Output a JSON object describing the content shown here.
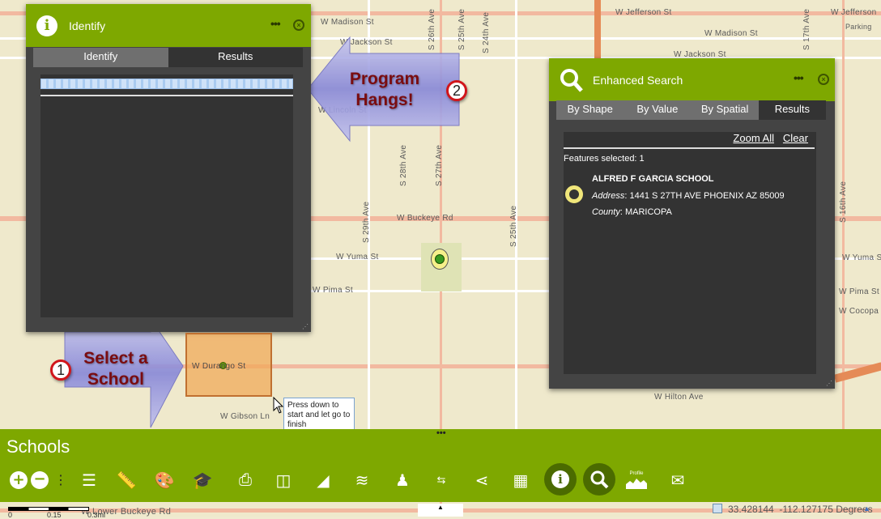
{
  "map": {
    "street_labels": [
      "W Madison St",
      "W Jackson St",
      "W Jefferson St",
      "W Madison St",
      "W Jackson St",
      "W Jefferson",
      "Parking",
      "W Lincoln St",
      "W Buckeye Rd",
      "W Yuma St",
      "W Pima St",
      "W Durango St",
      "W Gibson Ln",
      "W Hilton Ave",
      "W Lower Buckeye Rd",
      "S 26th Ave",
      "S 25th Ave",
      "S 24th Ave",
      "S 17th Ave",
      "S 28th Ave",
      "S 27th Ave",
      "S 29th Ave",
      "S 25th Ave",
      "S 16th Ave",
      "W Yuma St",
      "W Pima St",
      "W Cocopa St"
    ],
    "tooltip": "Press down to start and let go to finish",
    "scale_labels": [
      "0",
      "0.15",
      "0.3mi"
    ],
    "coordinates": "33.428144  -112.127175 Degrees"
  },
  "identify": {
    "title": "Identify",
    "menu": "•••",
    "close": "×",
    "tabs": [
      "Identify",
      "Results"
    ],
    "progress_indeterminate": true
  },
  "search": {
    "title": "Enhanced Search",
    "menu": "•••",
    "close": "×",
    "tabs": [
      "By Shape",
      "By Value",
      "By Spatial",
      "Results"
    ],
    "zoom_all": "Zoom All",
    "clear": "Clear",
    "features_selected": "Features selected: 1",
    "result": {
      "name": "ALFRED F GARCIA SCHOOL",
      "address_label": "Address",
      "address": "1441 S 27TH AVE PHOENIX AZ 85009",
      "county_label": "County",
      "county": "MARICOPA"
    }
  },
  "toolbar": {
    "title": "Schools",
    "handle": "•••",
    "tools": [
      "zoom-in",
      "zoom-out",
      "more",
      "legend",
      "measure",
      "symbology",
      "schools",
      "print",
      "swipe",
      "chart",
      "layers",
      "street-view",
      "directions",
      "share",
      "dashboard",
      "identify",
      "enhanced-search",
      "profile",
      "mailbox"
    ],
    "profile_label": "Profile"
  },
  "annotations": {
    "callout1": "Select a School",
    "badge1": "1",
    "callout2": "Program Hangs!",
    "badge2": "2"
  },
  "colors": {
    "accent": "#7ea800",
    "panel": "#444444",
    "active_tool": "#4b6b00",
    "callout_text": "#7a0c10"
  }
}
